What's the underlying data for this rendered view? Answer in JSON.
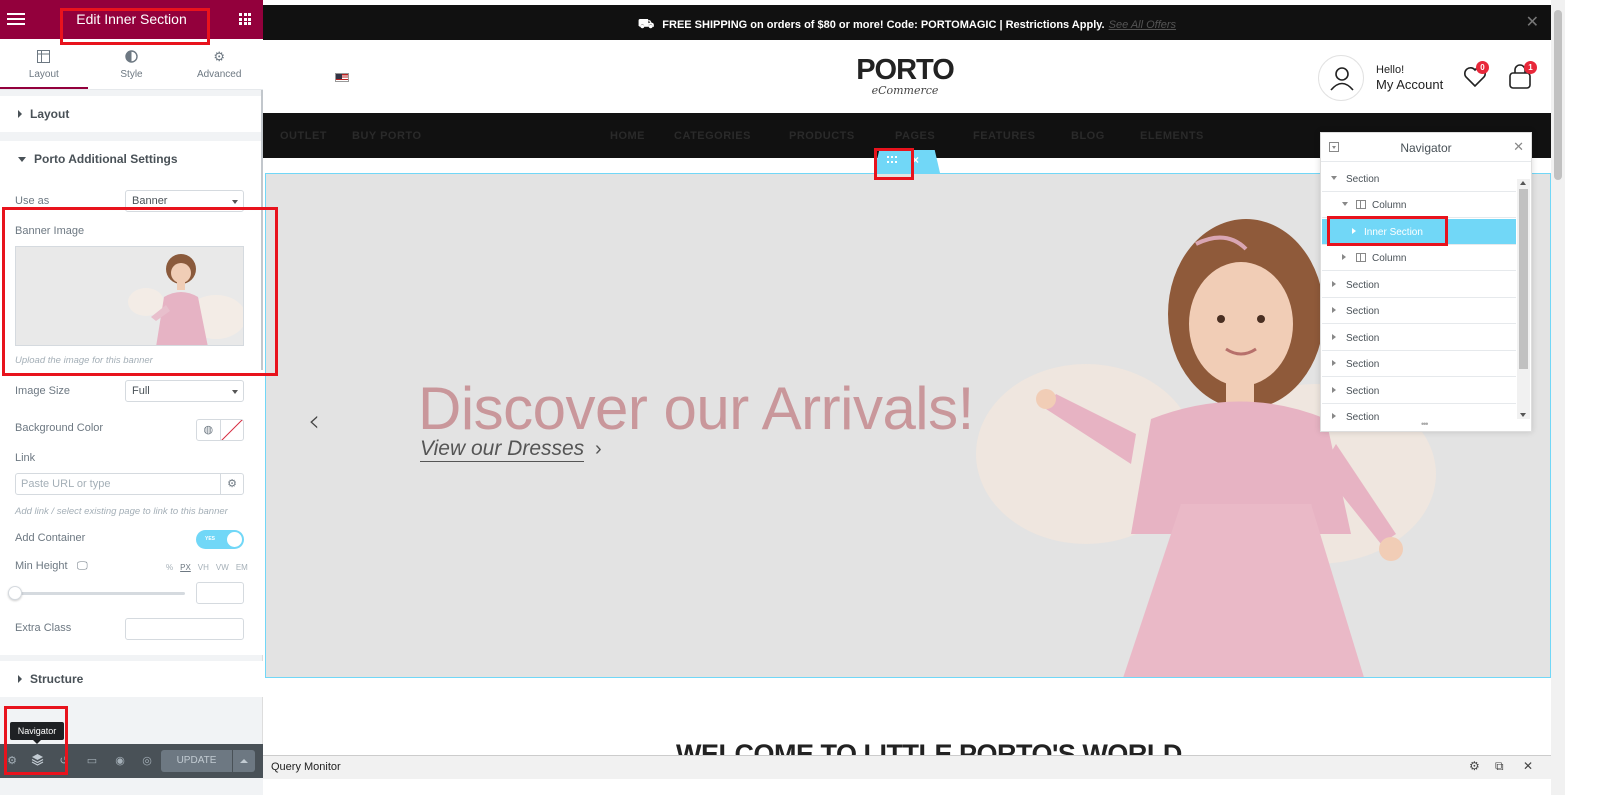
{
  "panel": {
    "title": "Edit Inner Section",
    "tabs": [
      {
        "label": "Layout",
        "icon": "layout-icon"
      },
      {
        "label": "Style",
        "icon": "style-icon"
      },
      {
        "label": "Advanced",
        "icon": "gear-icon"
      }
    ],
    "sections": {
      "layout": "Layout",
      "porto": "Porto Additional Settings",
      "structure": "Structure"
    },
    "controls": {
      "use_as_label": "Use as",
      "use_as_value": "Banner",
      "banner_image_label": "Banner Image",
      "banner_image_help": "Upload the image for this banner",
      "image_size_label": "Image Size",
      "image_size_value": "Full",
      "bg_color_label": "Background Color",
      "link_label": "Link",
      "link_placeholder": "Paste URL or type",
      "link_help": "Add link / select existing page to link to this banner",
      "add_container_label": "Add Container",
      "add_container_toggle": "YES",
      "min_height_label": "Min Height",
      "units": [
        "%",
        "PX",
        "VH",
        "VW",
        "EM"
      ],
      "extra_class_label": "Extra Class"
    },
    "footer": {
      "update_label": "UPDATE",
      "tooltip": "Navigator"
    }
  },
  "site": {
    "topbar_text": "FREE SHIPPING on orders of $80 or more! Code: PORTOMAGIC | Restrictions Apply.",
    "topbar_link": "See All Offers",
    "logo_main": "PORTO",
    "logo_sub": "eCommerce",
    "account_hello": "Hello!",
    "account_label": "My Account",
    "wishlist_count": "0",
    "cart_count": "1",
    "nav": [
      "OUTLET",
      "BUY PORTO",
      "HOME",
      "CATEGORIES",
      "PRODUCTS",
      "PAGES",
      "FEATURES",
      "BLOG",
      "ELEMENTS"
    ],
    "headline": "Discover our Arrivals!",
    "subline": "View our Dresses",
    "welcome": "WELCOME TO LITTLE PORTO'S WORLD",
    "query_monitor": "Query Monitor"
  },
  "navigator": {
    "title": "Navigator",
    "items": [
      {
        "label": "Section",
        "level": 0,
        "expanded": true
      },
      {
        "label": "Column",
        "level": 1,
        "expanded": true
      },
      {
        "label": "Inner Section",
        "level": 2,
        "selected": true
      },
      {
        "label": "Column",
        "level": 1,
        "expanded": false
      },
      {
        "label": "Section",
        "level": 0
      },
      {
        "label": "Section",
        "level": 0
      },
      {
        "label": "Section",
        "level": 0
      },
      {
        "label": "Section",
        "level": 0
      },
      {
        "label": "Section",
        "level": 0
      },
      {
        "label": "Section",
        "level": 0
      }
    ]
  },
  "colors": {
    "brand": "#93003c",
    "accent": "#71d7f7",
    "highlight": "#e8131d",
    "headline": "#c9979b"
  }
}
